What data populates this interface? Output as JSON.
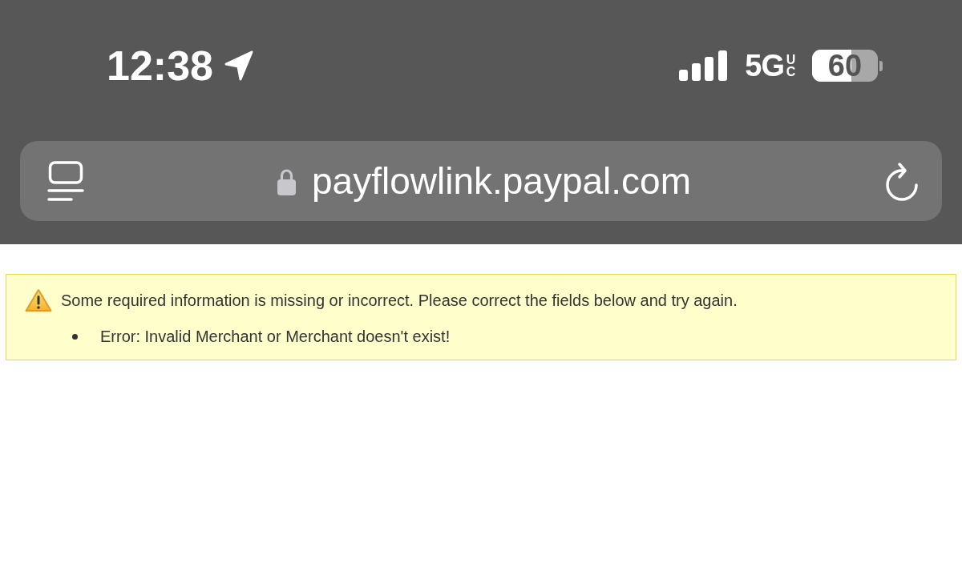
{
  "status_bar": {
    "time": "12:38",
    "network": "5G",
    "network_badge": "UC",
    "battery_text": "60"
  },
  "address_bar": {
    "url": "payflowlink.paypal.com",
    "secure": true
  },
  "alert": {
    "message": "Some required information is missing or incorrect. Please correct the fields below and try again.",
    "errors": [
      "Error: Invalid Merchant or Merchant doesn't exist!"
    ]
  }
}
